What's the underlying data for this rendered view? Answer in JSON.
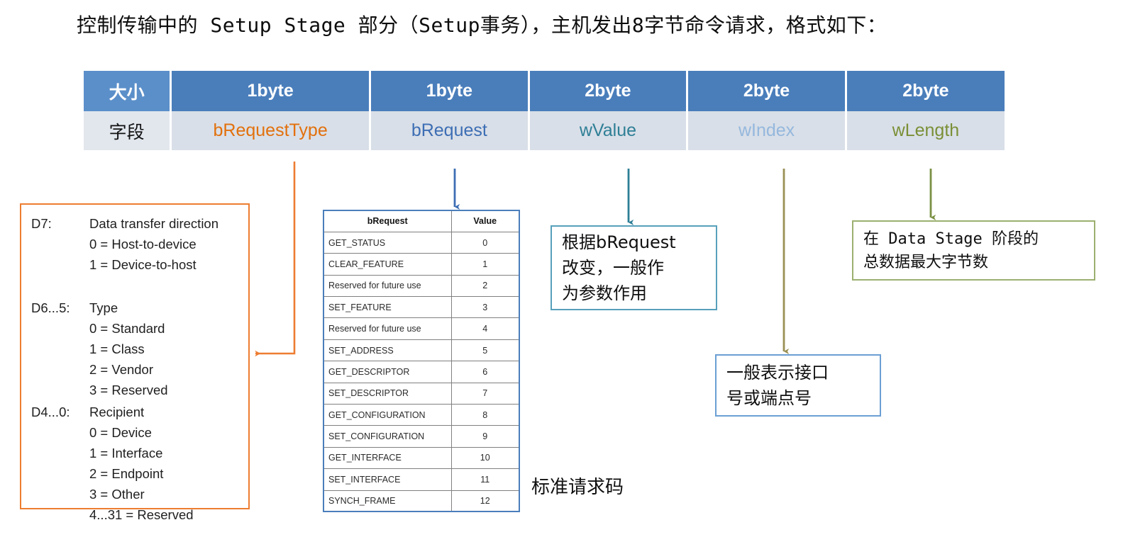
{
  "title": "控制传输中的 Setup Stage 部分（Setup事务），主机发出8字节命令请求，格式如下：",
  "field_table": {
    "row_labels": {
      "size": "大小",
      "field": "字段"
    },
    "columns": [
      {
        "size": "1byte",
        "field": "bRequestType",
        "color": "#e2700c"
      },
      {
        "size": "1byte",
        "field": "bRequest",
        "color": "#3d6eb4"
      },
      {
        "size": "2byte",
        "field": "wValue",
        "color": "#2e7f96"
      },
      {
        "size": "2byte",
        "field": "wIndex",
        "color": "#95b8dd"
      },
      {
        "size": "2byte",
        "field": "wLength",
        "color": "#7a8f36"
      }
    ],
    "header_bg": "#4a7ebb",
    "field_bg": "#d9dfe8"
  },
  "bmrequesttype_box": {
    "border_color": "#ed7d31",
    "groups": [
      {
        "label": "D7:",
        "values": "Data transfer direction\n0 = Host-to-device\n1 = Device-to-host"
      },
      {
        "label": "D6...5:",
        "values": "Type\n0 = Standard\n1 = Class\n2 = Vendor\n3 = Reserved"
      },
      {
        "label": "D4...0:",
        "values": "Recipient\n0 = Device\n1 = Interface\n2 = Endpoint\n3 = Other\n4...31 = Reserved"
      }
    ]
  },
  "brequest_table": {
    "headers": [
      "bRequest",
      "Value"
    ],
    "rows": [
      [
        "GET_STATUS",
        "0"
      ],
      [
        "CLEAR_FEATURE",
        "1"
      ],
      [
        "Reserved for future use",
        "2"
      ],
      [
        "SET_FEATURE",
        "3"
      ],
      [
        "Reserved for future use",
        "4"
      ],
      [
        "SET_ADDRESS",
        "5"
      ],
      [
        "GET_DESCRIPTOR",
        "6"
      ],
      [
        "SET_DESCRIPTOR",
        "7"
      ],
      [
        "GET_CONFIGURATION",
        "8"
      ],
      [
        "SET_CONFIGURATION",
        "9"
      ],
      [
        "GET_INTERFACE",
        "10"
      ],
      [
        "SET_INTERFACE",
        "11"
      ],
      [
        "SYNCH_FRAME",
        "12"
      ]
    ],
    "caption": "标准请求码",
    "border_color": "#4a7ebb"
  },
  "callouts": {
    "wvalue": {
      "text": "根据bRequest\n改变，一般作\n为参数作用",
      "border_color": "#57a0bb",
      "arrow_color": "#3d6eb4"
    },
    "windex": {
      "text": "一般表示接口\n号或端点号",
      "border_color": "#6b9fd4",
      "arrow_color": "#9a9055"
    },
    "wlength": {
      "text": "在 Data Stage 阶段的\n总数据最大字节数",
      "border_color": "#9cb070",
      "arrow_color": "#7a9144"
    }
  },
  "arrows": {
    "brequest_arrow_color": "#3d6eb4",
    "wvalue_arrow_color": "#2e7f96",
    "windex_arrow_color": "#9a9055",
    "wlength_arrow_color": "#7a9144",
    "brequesttype_connector_color": "#ed7d31"
  }
}
